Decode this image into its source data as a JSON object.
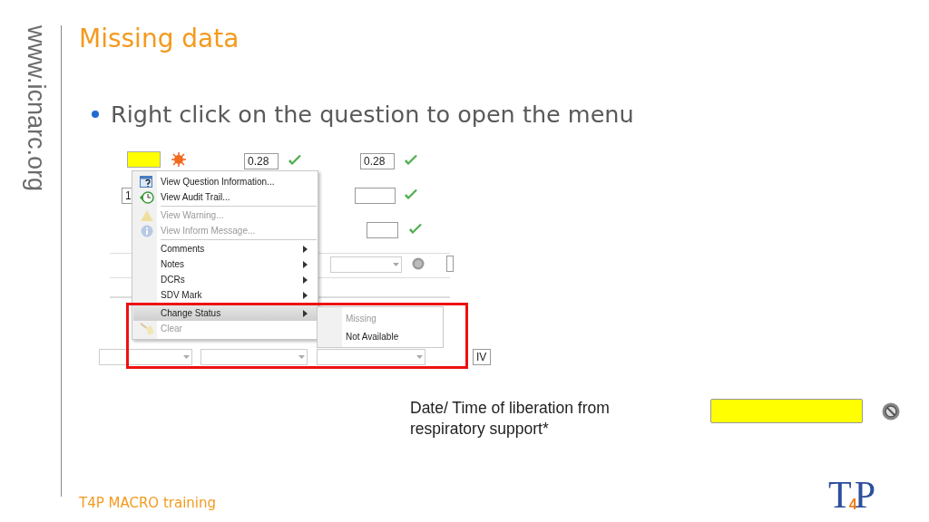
{
  "slide": {
    "side_url": "www.icnarc.org",
    "title": "Missing data",
    "bullets": [
      "Right click on the question to open the menu"
    ],
    "footer": "T4P MACRO training",
    "logo": [
      "T",
      "4",
      "P"
    ]
  },
  "form": {
    "rows": [
      {
        "fields": [
          {
            "kind": "input",
            "highlighted": true,
            "warning": true
          },
          {
            "kind": "input",
            "value": "0.28",
            "validated": true
          },
          {
            "kind": "input",
            "value": "0.28",
            "validated": true
          }
        ]
      },
      {
        "fields": [
          {
            "kind": "input",
            "value": "1"
          },
          {
            "kind": "input",
            "validated": true
          }
        ]
      },
      {
        "fields": [
          {
            "kind": "input",
            "validated": true
          }
        ]
      },
      {
        "fields": [
          {
            "kind": "select",
            "inactive": true
          },
          {
            "kind": "input"
          }
        ]
      },
      {
        "fields": [
          {
            "kind": "select"
          },
          {
            "kind": "select"
          },
          {
            "kind": "select"
          },
          {
            "kind": "input",
            "value": "IV"
          }
        ]
      }
    ]
  },
  "menu": {
    "items": [
      {
        "label": "View Question Information...",
        "disabled": false,
        "submenu": false,
        "selected": false,
        "separator_after": false
      },
      {
        "label": "View Audit Trail...",
        "disabled": false,
        "submenu": false,
        "selected": false,
        "separator_after": true
      },
      {
        "label": "View Warning...",
        "disabled": true,
        "submenu": false,
        "selected": false,
        "separator_after": false
      },
      {
        "label": "View Inform Message...",
        "disabled": true,
        "submenu": false,
        "selected": false,
        "separator_after": true
      },
      {
        "label": "Comments",
        "disabled": false,
        "submenu": true,
        "selected": false,
        "separator_after": false
      },
      {
        "label": "Notes",
        "disabled": false,
        "submenu": true,
        "selected": false,
        "separator_after": false
      },
      {
        "label": "DCRs",
        "disabled": false,
        "submenu": true,
        "selected": false,
        "separator_after": false
      },
      {
        "label": "SDV Mark",
        "disabled": false,
        "submenu": true,
        "selected": false,
        "separator_after": true
      },
      {
        "label": "Change Status",
        "disabled": false,
        "submenu": true,
        "selected": true,
        "separator_after": false
      },
      {
        "label": "Clear",
        "disabled": true,
        "submenu": false,
        "selected": false,
        "separator_after": false
      }
    ]
  },
  "submenu": {
    "items": [
      {
        "label": "Missing",
        "disabled": true
      },
      {
        "label": "Not Available",
        "disabled": false
      }
    ]
  },
  "question": {
    "label": "Date/ Time of liberation from respiratory support*",
    "highlighted": true,
    "blocked": true
  }
}
